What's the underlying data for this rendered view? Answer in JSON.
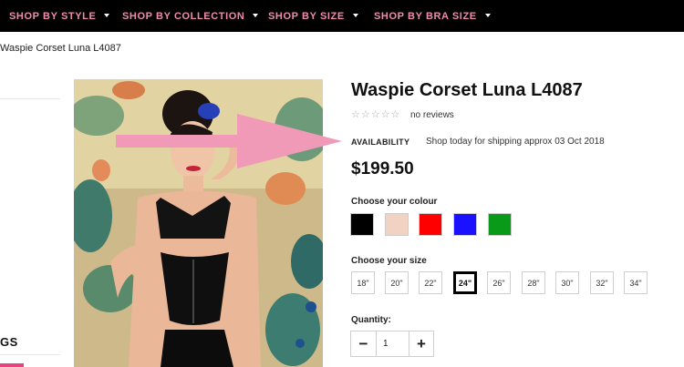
{
  "nav": {
    "items": [
      {
        "label": "SHOP BY STYLE"
      },
      {
        "label": "SHOP BY COLLECTION"
      },
      {
        "label": "SHOP BY SIZE"
      },
      {
        "label": "SHOP BY BRA SIZE"
      }
    ],
    "text_color": "#f08bb0",
    "caret_color": "#ffffff"
  },
  "breadcrumb": "Waspie Corset Luna L4087",
  "sidebar": {
    "heading_fragment": "GS",
    "accent_color": "#e8437e"
  },
  "product": {
    "title": "Waspie Corset Luna L4087",
    "rating_stars": 0,
    "rating_max": 5,
    "reviews": "no reviews",
    "availability_label": "AVAILABILITY",
    "availability_value": "Shop today for shipping approx 03 Oct 2018",
    "price": "$199.50"
  },
  "colours": {
    "label": "Choose your colour",
    "options": [
      {
        "name": "black",
        "hex": "#000000"
      },
      {
        "name": "nude",
        "hex": "#f2d2c2"
      },
      {
        "name": "red",
        "hex": "#ff0000"
      },
      {
        "name": "blue",
        "hex": "#1a12ff"
      },
      {
        "name": "green",
        "hex": "#0a9a1a"
      }
    ]
  },
  "sizes": {
    "label": "Choose your size",
    "options": [
      "18\"",
      "20\"",
      "22\"",
      "24\"",
      "26\"",
      "28\"",
      "30\"",
      "32\"",
      "34\""
    ],
    "selected": "24\""
  },
  "quantity": {
    "label": "Quantity:",
    "value": "1",
    "minus": "−",
    "plus": "+"
  },
  "annotation": {
    "arrow_color": "#f09ab8"
  }
}
